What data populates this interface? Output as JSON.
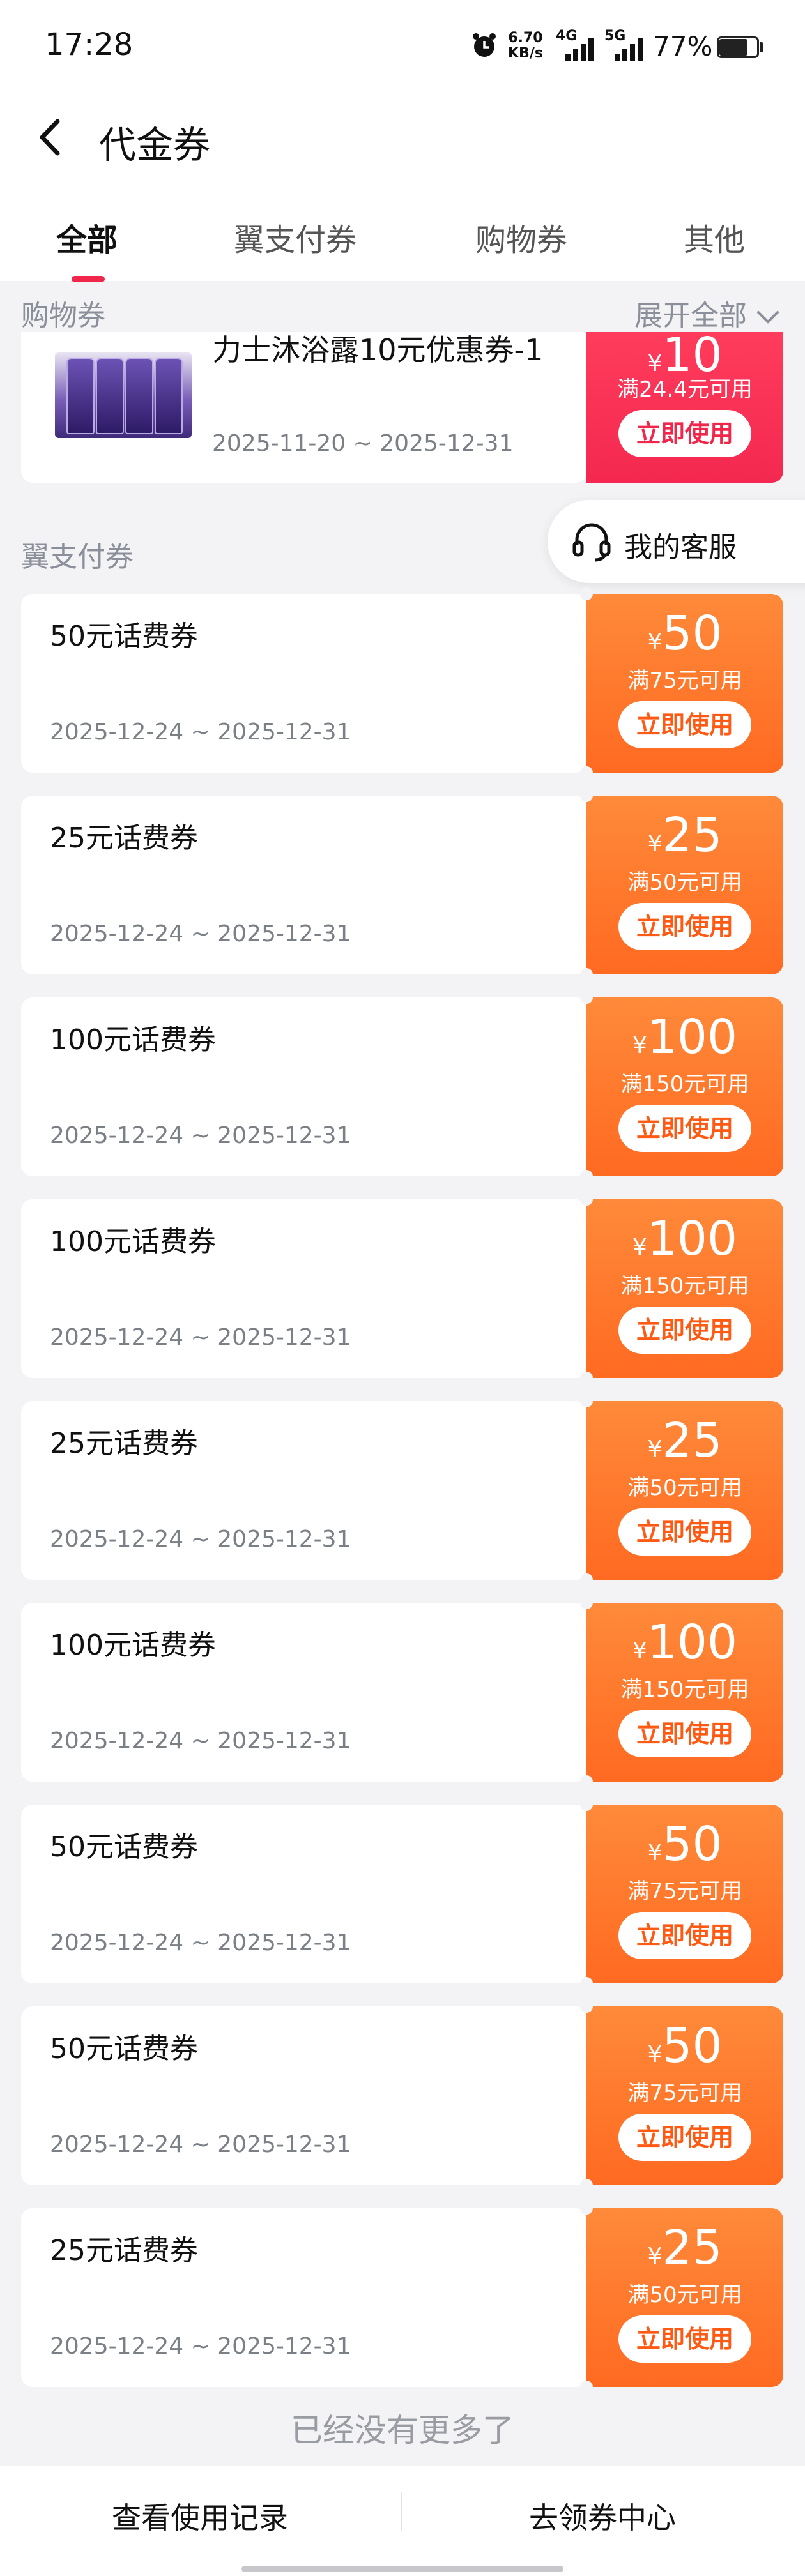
{
  "status_bar": {
    "time": "17:28",
    "speed_value": "6.70",
    "speed_unit": "KB/s",
    "net1": "4G",
    "net2": "5G",
    "battery": "77%"
  },
  "header": {
    "title": "代金券",
    "tabs": [
      "全部",
      "翼支付券",
      "购物券",
      "其他"
    ],
    "active_tab": "全部"
  },
  "shopping_section": {
    "label": "购物券",
    "expand_label": "展开全部",
    "card": {
      "title": "力士沐浴露10元优惠券-1",
      "date": "2025-11-20 ~ 2025-12-31",
      "currency": "¥",
      "amount": "10",
      "condition": "满24.4元可用",
      "button": "立即使用"
    }
  },
  "yzf_section": {
    "label": "翼支付券",
    "cards": [
      {
        "title": "50元话费券",
        "date": "2025-12-24 ~ 2025-12-31",
        "currency": "¥",
        "amount": "50",
        "condition": "满75元可用",
        "button": "立即使用"
      },
      {
        "title": "25元话费券",
        "date": "2025-12-24 ~ 2025-12-31",
        "currency": "¥",
        "amount": "25",
        "condition": "满50元可用",
        "button": "立即使用"
      },
      {
        "title": "100元话费券",
        "date": "2025-12-24 ~ 2025-12-31",
        "currency": "¥",
        "amount": "100",
        "condition": "满150元可用",
        "button": "立即使用"
      },
      {
        "title": "100元话费券",
        "date": "2025-12-24 ~ 2025-12-31",
        "currency": "¥",
        "amount": "100",
        "condition": "满150元可用",
        "button": "立即使用"
      },
      {
        "title": "25元话费券",
        "date": "2025-12-24 ~ 2025-12-31",
        "currency": "¥",
        "amount": "25",
        "condition": "满50元可用",
        "button": "立即使用"
      },
      {
        "title": "100元话费券",
        "date": "2025-12-24 ~ 2025-12-31",
        "currency": "¥",
        "amount": "100",
        "condition": "满150元可用",
        "button": "立即使用"
      },
      {
        "title": "50元话费券",
        "date": "2025-12-24 ~ 2025-12-31",
        "currency": "¥",
        "amount": "50",
        "condition": "满75元可用",
        "button": "立即使用"
      },
      {
        "title": "50元话费券",
        "date": "2025-12-24 ~ 2025-12-31",
        "currency": "¥",
        "amount": "50",
        "condition": "满75元可用",
        "button": "立即使用"
      },
      {
        "title": "25元话费券",
        "date": "2025-12-24 ~ 2025-12-31",
        "currency": "¥",
        "amount": "25",
        "condition": "满50元可用",
        "button": "立即使用"
      }
    ]
  },
  "service": {
    "label": "我的客服",
    "icon": "headset-icon"
  },
  "footer": {
    "no_more": "已经没有更多了",
    "left_button": "查看使用记录",
    "right_button": "去领券中心"
  },
  "colors": {
    "accent": "#f0264b",
    "voucher_orange": "#ff7a2b",
    "voucher_red": "#f42850"
  }
}
